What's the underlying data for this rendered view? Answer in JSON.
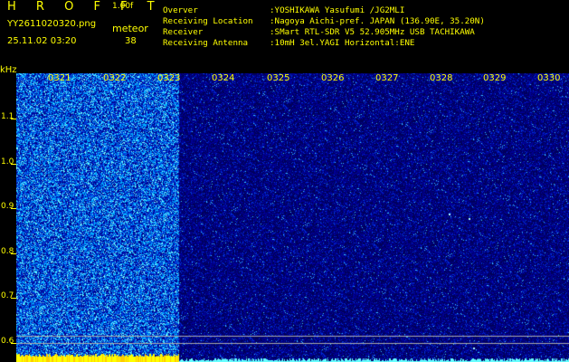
{
  "header": {
    "title": "H R O F F T",
    "version": "1.00f",
    "filename": "YY2611020320.png",
    "meteor_label": "meteor",
    "datetime": "25.11.02 03:20",
    "meteor_count": "38"
  },
  "station": {
    "labels": [
      "Overver",
      "Receiving Location",
      "Receiver",
      "Receiving Antenna"
    ],
    "values": [
      ":YOSHIKAWA Yasufumi /JG2MLI",
      ":Nagoya Aichi-pref. JAPAN (136.90E, 35.20N)",
      ":SMart RTL-SDR V5 52.905MHz USB TACHIKAWA",
      ":10mH 3el.YAGI Horizontal:ENE"
    ]
  },
  "axis": {
    "y_unit": "kHz",
    "y_ticks": [
      "1.1",
      "1.0",
      "0.9",
      "0.8",
      "0.7",
      "0.6"
    ],
    "x_ticks": [
      "0321",
      "0322",
      "0323",
      "0324",
      "0325",
      "0326",
      "0327",
      "0328",
      "0329",
      "0330"
    ]
  },
  "colors": {
    "text": "#ffff00",
    "background": "#000000",
    "noise_low": "#000066",
    "noise_high": "#66ffff"
  },
  "waterfall": {
    "bright_segment_minutes": 3
  }
}
